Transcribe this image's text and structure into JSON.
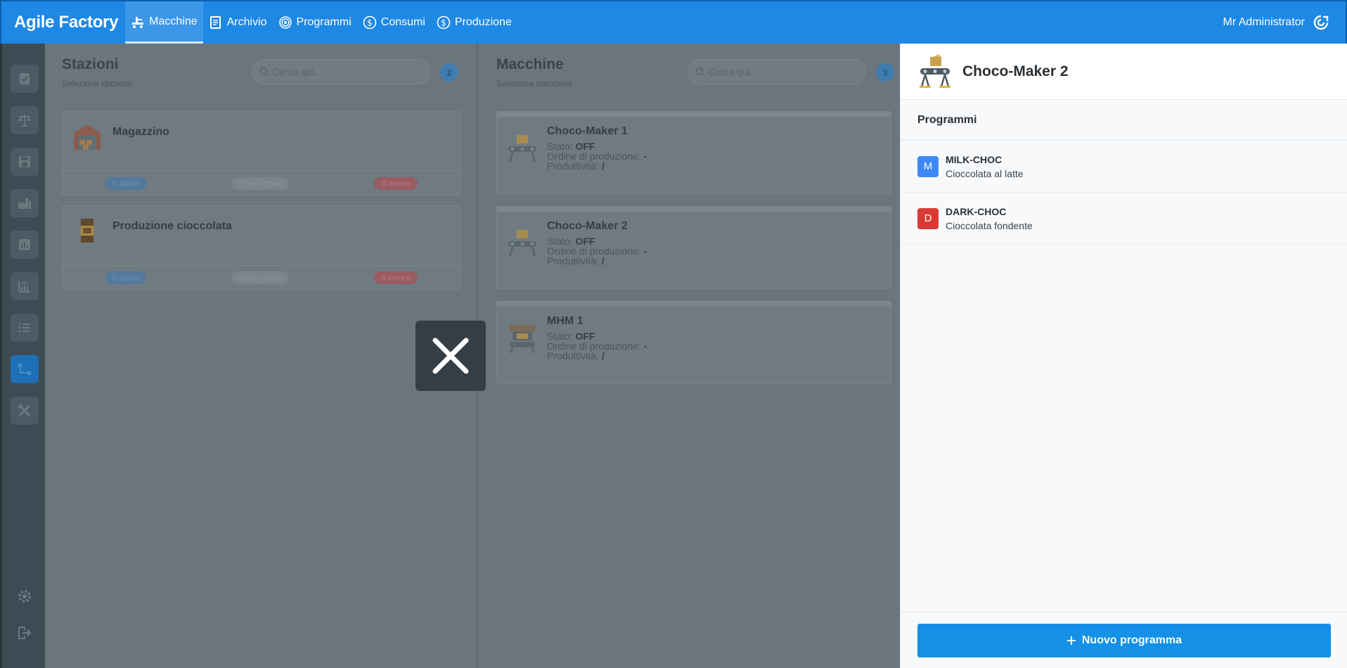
{
  "topbar": {
    "brand": "Agile Factory",
    "nav": [
      {
        "label": "Macchine",
        "icon": "machine-icon",
        "active": true
      },
      {
        "label": "Archivio",
        "icon": "archive-icon"
      },
      {
        "label": "Programmi",
        "icon": "programs-icon"
      },
      {
        "label": "Consumi",
        "icon": "dollar-icon"
      },
      {
        "label": "Produzione",
        "icon": "dollar-icon"
      }
    ],
    "user": "Mr Administrator",
    "accent": "#1e88e5"
  },
  "stations": {
    "title": "Stazioni",
    "subtitle": "Seleziona stazione",
    "search_placeholder": "Cerca qui...",
    "count": "2",
    "items": [
      {
        "name": "Magazzino",
        "active": "0 attive",
        "inactive": "2 non attive",
        "errors": "0 errore"
      },
      {
        "name": "Produzione cioccolata",
        "active": "0 attive",
        "inactive": "3 non attive",
        "errors": "0 errore"
      }
    ]
  },
  "machines": {
    "title": "Macchine",
    "subtitle": "Seleziona macchina",
    "search_placeholder": "Cerca qui...",
    "count": "3",
    "state_label": "Stato:",
    "order_label": "Ordine di produzione:",
    "productivity_label": "Produttività:",
    "items": [
      {
        "name": "Choco-Maker 1",
        "state": "OFF",
        "order": "-",
        "productivity": "/"
      },
      {
        "name": "Choco-Maker 2",
        "state": "OFF",
        "order": "-",
        "productivity": "/"
      },
      {
        "name": "MHM 1",
        "state": "OFF",
        "order": "-",
        "productivity": "/"
      }
    ]
  },
  "drawer": {
    "title": "Choco-Maker 2",
    "section": "Programmi",
    "programs": [
      {
        "badge": "M",
        "code": "MILK-CHOC",
        "description": "Cioccolata al latte",
        "color": "#3d8af7"
      },
      {
        "badge": "D",
        "code": "DARK-CHOC",
        "description": "Cioccolata fondente",
        "color": "#d93a35"
      }
    ],
    "new_button": "Nuovo programma",
    "button_color": "#1490e6"
  }
}
